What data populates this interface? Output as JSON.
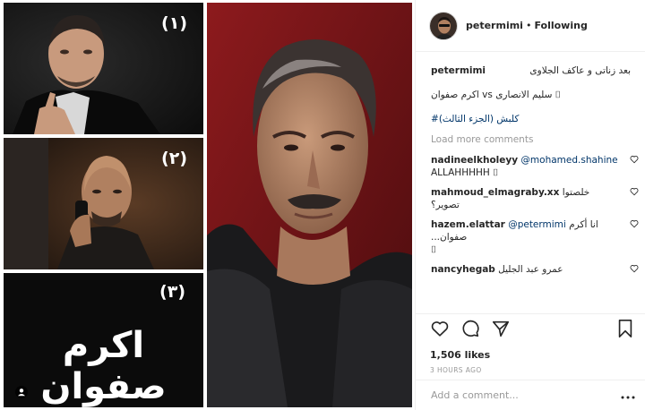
{
  "post": {
    "image_labels": {
      "tile1_number": "(١)",
      "tile2_number": "(٢)",
      "tile3_number": "(٣)",
      "tile3_name": "اكرم صفوان"
    }
  },
  "header": {
    "username": "petermimi",
    "separator": "•",
    "follow_status": "Following"
  },
  "caption": {
    "username": "petermimi",
    "line1": "بعد زناتى و عاكف الجلاوى",
    "line2": "اكرم صفوان vs سليم الانصارى ⌷",
    "hashtag": "#كلبش (الجزء الثالث)"
  },
  "load_more_label": "Load more comments",
  "comments": [
    {
      "username": "nadineelkholeyy",
      "mention": "@mohamed.shahine",
      "text": "ALLAHHHHH ⌷"
    },
    {
      "username": "mahmoud_elmagraby.xx",
      "mention": "",
      "text": "خلصتوا تصوير؟"
    },
    {
      "username": "hazem.elattar",
      "mention": "@petermimi",
      "text": "انا أكرم صفوان...",
      "text2": "⌷"
    },
    {
      "username": "nancyhegab",
      "mention": "",
      "text": "عمرو عبد الجليل"
    }
  ],
  "actions": {
    "likes": "1,506 likes",
    "time": "3 HOURS AGO",
    "icons": [
      "heart-icon",
      "comment-icon",
      "share-icon",
      "bookmark-icon"
    ]
  },
  "add_comment": {
    "placeholder": "Add a comment...",
    "more_icon": "more-options-icon"
  },
  "colors": {
    "link": "#003569",
    "muted": "#999999",
    "border": "#efefef",
    "poster_red": "#7e1518"
  }
}
